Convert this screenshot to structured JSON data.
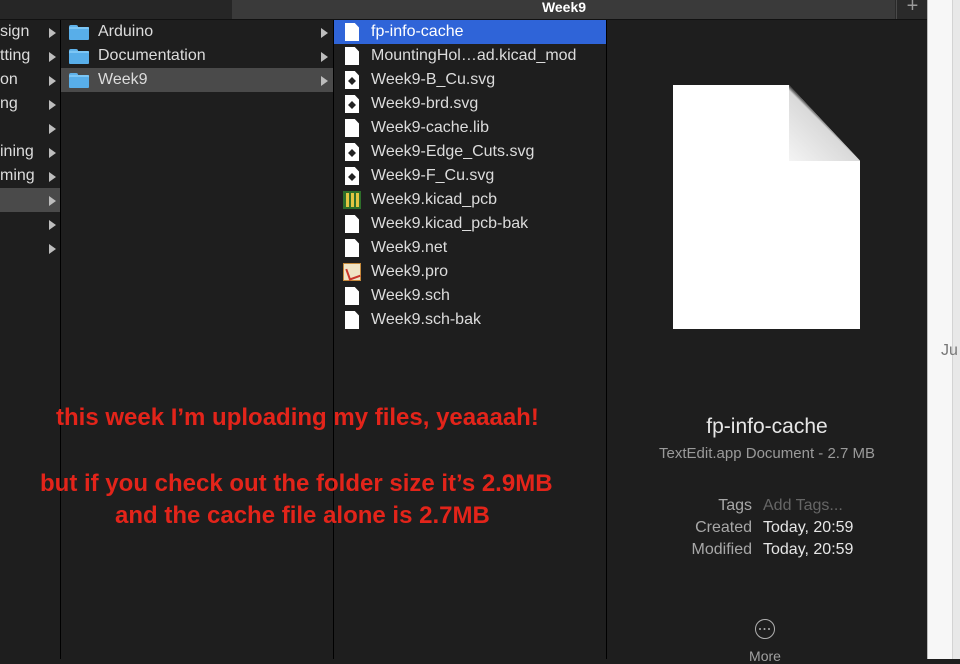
{
  "tabs": {
    "active_label": "Week9",
    "new_tab_label": "+"
  },
  "column1": {
    "items": [
      {
        "label": "sign"
      },
      {
        "label": "tting"
      },
      {
        "label": "on"
      },
      {
        "label": "ng"
      },
      {
        "label": ""
      },
      {
        "label": "ining"
      },
      {
        "label": "ming"
      },
      {
        "label": ""
      },
      {
        "label": ""
      },
      {
        "label": ""
      }
    ]
  },
  "column2": {
    "items": [
      {
        "label": "Arduino"
      },
      {
        "label": "Documentation"
      },
      {
        "label": "Week9"
      }
    ]
  },
  "column3": {
    "items": [
      {
        "label": "fp-info-cache",
        "icon": "document-icon"
      },
      {
        "label": "MountingHol…ad.kicad_mod",
        "icon": "document-icon"
      },
      {
        "label": "Week9-B_Cu.svg",
        "icon": "svg-document-icon"
      },
      {
        "label": "Week9-brd.svg",
        "icon": "svg-document-icon"
      },
      {
        "label": "Week9-cache.lib",
        "icon": "document-icon"
      },
      {
        "label": "Week9-Edge_Cuts.svg",
        "icon": "svg-document-icon"
      },
      {
        "label": "Week9-F_Cu.svg",
        "icon": "svg-document-icon"
      },
      {
        "label": "Week9.kicad_pcb",
        "icon": "kicad-pcb-icon"
      },
      {
        "label": "Week9.kicad_pcb-bak",
        "icon": "document-icon"
      },
      {
        "label": "Week9.net",
        "icon": "document-icon"
      },
      {
        "label": "Week9.pro",
        "icon": "kicad-project-icon"
      },
      {
        "label": "Week9.sch",
        "icon": "document-icon"
      },
      {
        "label": "Week9.sch-bak",
        "icon": "document-icon"
      }
    ]
  },
  "preview": {
    "name": "fp-info-cache",
    "kind": "TextEdit.app Document - 2.7 MB",
    "tags_label": "Tags",
    "tags_placeholder": "Add Tags...",
    "created_label": "Created",
    "created_value": "Today, 20:59",
    "modified_label": "Modified",
    "modified_value": "Today, 20:59",
    "more_label": "More"
  },
  "right_edge": {
    "text": "Ju"
  },
  "annotation": {
    "line1": "this week I’m uploading my files, yeaaaah!",
    "line2": "but if you check out the folder size it’s 2.9MB",
    "line3": "and the cache file alone is 2.7MB",
    "color": "#e3241a"
  }
}
